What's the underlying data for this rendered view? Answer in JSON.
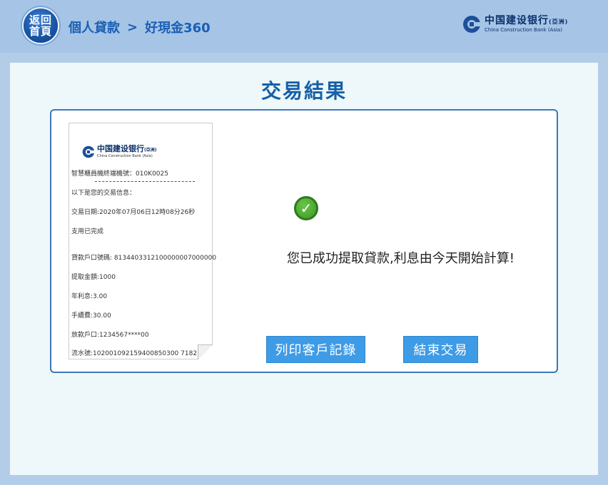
{
  "header": {
    "home_label": "返回首頁",
    "breadcrumb": [
      "個人貸款",
      "好現金360"
    ],
    "separator": ">",
    "bank": {
      "name_zh": "中国建设银行",
      "name_suffix": "(亞洲)",
      "name_en": "China Construction Bank (Asia)"
    }
  },
  "main": {
    "title": "交易結果",
    "receipt": {
      "bank_zh": "中国建设银行",
      "bank_suffix": "(亞洲)",
      "bank_en": "China Construction Bank (Asia)",
      "terminal": "智慧櫃員機終端機號：010K0025",
      "intro": "以下是您的交易信息：",
      "date": "交易日期:2020年07月06日12時08分26秒",
      "status": "支用已完成",
      "loan_account": "貸款戶口號碼: 8134403312100000007000000",
      "amount": "提取金額:1000",
      "rate": "年利息:3.00",
      "fee": "手續費:30.00",
      "payout_account": "放款戶口:1234567****00",
      "serial": "流水號:102001092159400850300 7182"
    },
    "success_message": "您已成功提取貸款,利息由今天開始計算!",
    "buttons": {
      "print": "列印客戶記錄",
      "end": "結束交易"
    }
  },
  "colors": {
    "accent": "#1660a8",
    "button": "#3e9be6",
    "header": "#a6c4e6",
    "success": "#3a9a22"
  },
  "icons": {
    "bank_logo": "ccb-logo-icon",
    "success": "check-circle-icon"
  }
}
